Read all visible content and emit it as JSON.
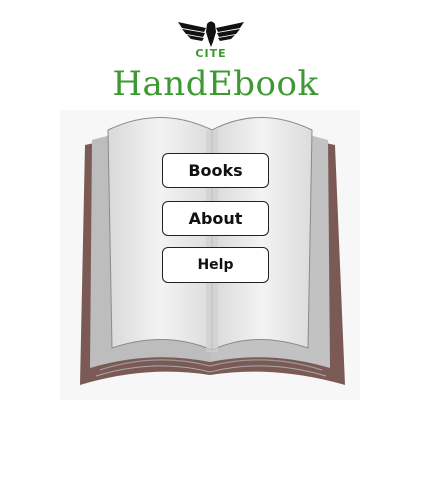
{
  "header": {
    "logo_text": "CITE",
    "app_title": "HandEbook"
  },
  "menu": {
    "books_label": "Books",
    "about_label": "About",
    "help_label": "Help"
  },
  "colors": {
    "brand_green": "#3d9a33",
    "book_cover": "#7b5a55",
    "page_gray": "#e6e6e6"
  },
  "icons": [
    "eagle-logo-icon",
    "open-book-illustration"
  ]
}
